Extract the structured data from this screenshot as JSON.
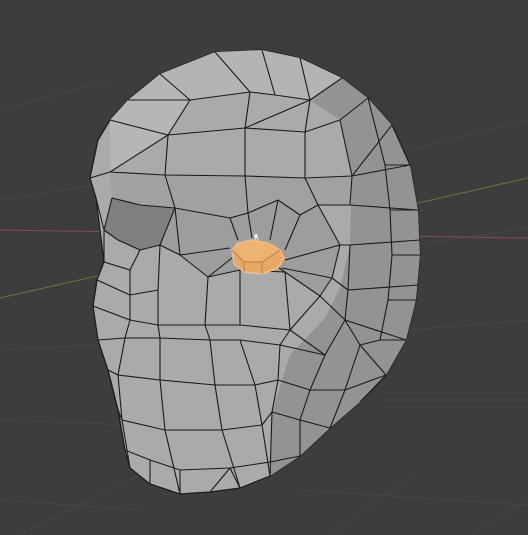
{
  "viewport": {
    "background": "#3d3d3d",
    "grid_color": "#474747",
    "x_axis_color": "#8a4a55",
    "y_axis_color": "#5e7a3a"
  },
  "mesh": {
    "object": "head",
    "display": "solid-with-wireframe",
    "surface_color": "#a9abab",
    "shadow_color": "#8c8e8e",
    "highlight_color": "#b7b9b9",
    "edge_color": "#1a1a1a",
    "selection": {
      "element": "eye-socket-face",
      "fill_color": "#e8a866",
      "edge_color": "#f0c090",
      "vertex_color": "#ffffff"
    }
  }
}
